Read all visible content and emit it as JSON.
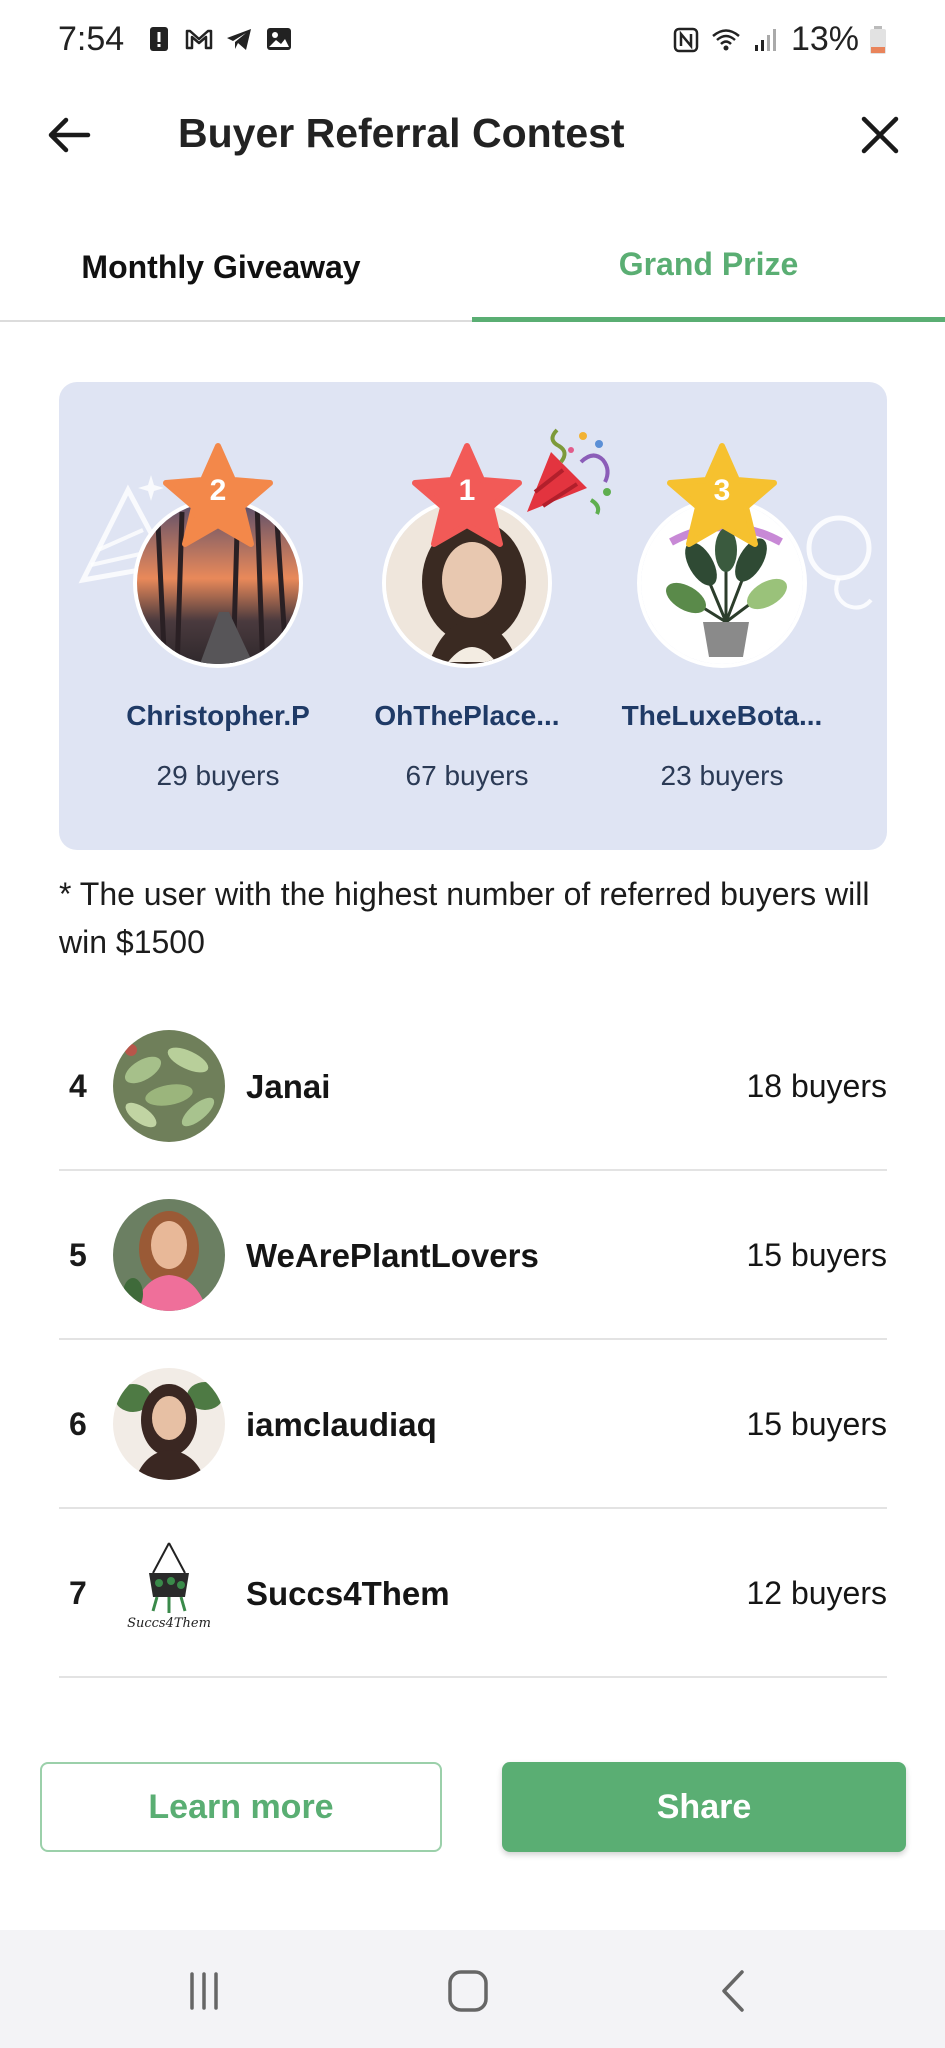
{
  "status_bar": {
    "time": "7:54",
    "battery": "13%",
    "left_icons": [
      "alert-icon",
      "gmail-icon",
      "telegram-icon",
      "gallery-icon"
    ],
    "right_icons": [
      "nfc-icon",
      "wifi-icon",
      "signal-icon",
      "battery-icon"
    ]
  },
  "header": {
    "title": "Buyer Referral Contest",
    "back_icon": "arrow-left-icon",
    "close_icon": "close-icon"
  },
  "tabs": [
    {
      "label": "Monthly Giveaway",
      "active": false
    },
    {
      "label": "Grand Prize",
      "active": true
    }
  ],
  "podium": [
    {
      "rank": "2",
      "name": "Christopher.P",
      "buyers": "29 buyers",
      "star_color": "#f3884a"
    },
    {
      "rank": "1",
      "name": "OhThePlace...",
      "buyers": "67 buyers",
      "star_color": "#f25a57"
    },
    {
      "rank": "3",
      "name": "TheLuxeBota...",
      "buyers": "23 buyers",
      "star_color": "#f6c12f"
    }
  ],
  "note": "* The user with the highest number of referred buyers will win $1500",
  "leaderboard": [
    {
      "rank": "4",
      "name": "Janai",
      "buyers": "18 buyers"
    },
    {
      "rank": "5",
      "name": "WeArePlantLovers",
      "buyers": "15 buyers"
    },
    {
      "rank": "6",
      "name": "iamclaudiaq",
      "buyers": "15 buyers"
    },
    {
      "rank": "7",
      "name": "Succs4Them",
      "buyers": "12 buyers",
      "logo_text": "Succs4Them"
    }
  ],
  "buttons": {
    "learn_more": "Learn more",
    "share": "Share"
  },
  "colors": {
    "accent": "#5aae73",
    "podium_bg": "#dfe4f3",
    "name_blue": "#1f3a66"
  },
  "navbar": [
    "recent-apps-icon",
    "home-icon",
    "back-icon"
  ]
}
